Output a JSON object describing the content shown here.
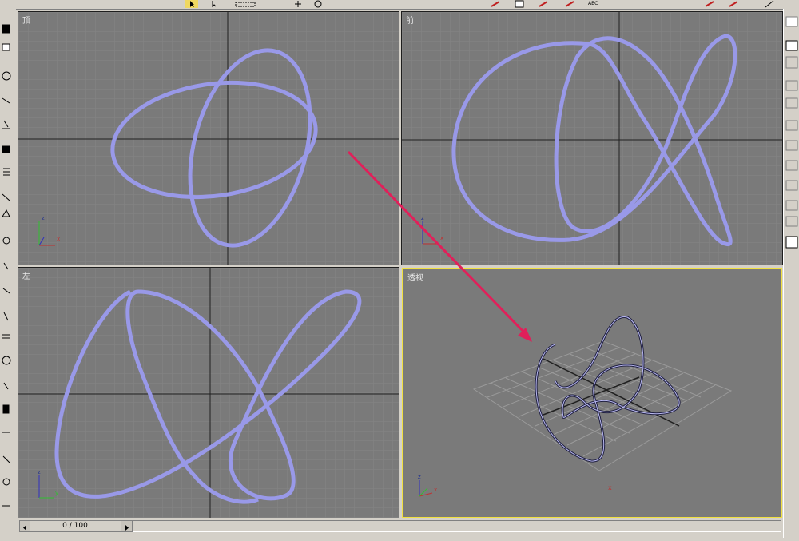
{
  "viewports": {
    "top": {
      "label": "顶"
    },
    "front": {
      "label": "前"
    },
    "left": {
      "label": "左"
    },
    "perspective": {
      "label": "透视"
    }
  },
  "axis": {
    "x": "x",
    "y": "y",
    "z": "z"
  },
  "timeline": {
    "frame_display": "0 / 100"
  },
  "toolbar": {
    "abc_label": "ABC"
  },
  "colors": {
    "viewport_bg": "#7a7a7a",
    "spline": "#9999e8",
    "active_border": "#f0e040",
    "arrow": "#e0205a",
    "grid": "#8a8a8a"
  },
  "icons": [
    "select-arrow-icon",
    "move-icon",
    "rotate-icon",
    "snap-icon",
    "mirror-icon",
    "align-icon",
    "material-icon",
    "render-icon"
  ]
}
